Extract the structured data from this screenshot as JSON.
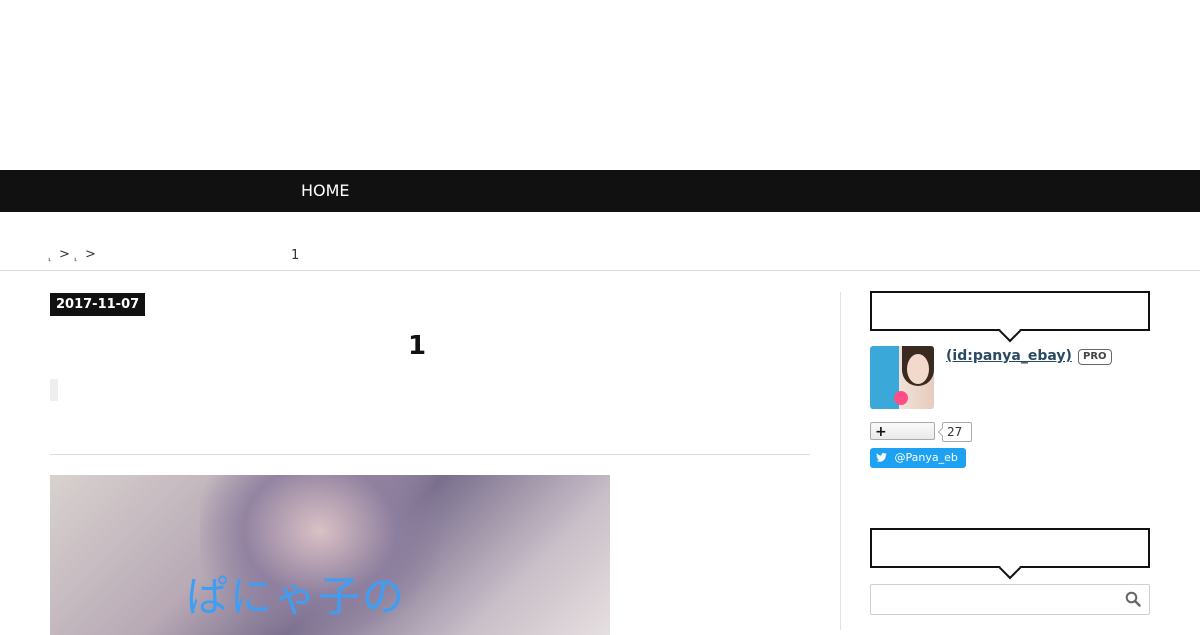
{
  "nav": {
    "home_label": "HOME"
  },
  "breadcrumb": {
    "sep1": ">",
    "sep2": ">",
    "current": "1"
  },
  "entry": {
    "date": "2017-11-07",
    "title": "1",
    "eyecatch_text": "ぱにゃ子の"
  },
  "sidebar": {
    "profile": {
      "id_label": " (id:panya_ebay)",
      "pro_badge": "PRO",
      "follow_icon": "+",
      "follow_count": "27",
      "twitter_handle": "@Panya_eb"
    },
    "search": {
      "placeholder": "",
      "value": ""
    }
  },
  "colors": {
    "nav_bg": "#111111",
    "twitter_blue": "#1da1f2",
    "link": "#2a4a62",
    "eyecatch_text": "#3e9ef4"
  },
  "icons": [
    "plus-icon",
    "twitter-bird-icon",
    "search-icon"
  ]
}
